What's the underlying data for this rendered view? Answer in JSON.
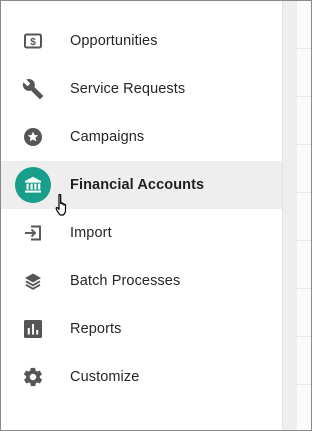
{
  "menu": {
    "items": [
      {
        "label": "Opportunities",
        "icon": "dollar-sign-icon"
      },
      {
        "label": "Service Requests",
        "icon": "wrench-icon"
      },
      {
        "label": "Campaigns",
        "icon": "star-circle-icon"
      },
      {
        "label": "Financial Accounts",
        "icon": "bank-icon",
        "active": true
      },
      {
        "label": "Import",
        "icon": "import-icon"
      },
      {
        "label": "Batch Processes",
        "icon": "layers-icon"
      },
      {
        "label": "Reports",
        "icon": "bar-chart-icon"
      },
      {
        "label": "Customize",
        "icon": "gear-icon"
      }
    ]
  },
  "colors": {
    "accent": "#189e8b",
    "icon": "#555555",
    "active_background": "#eeeeee"
  }
}
